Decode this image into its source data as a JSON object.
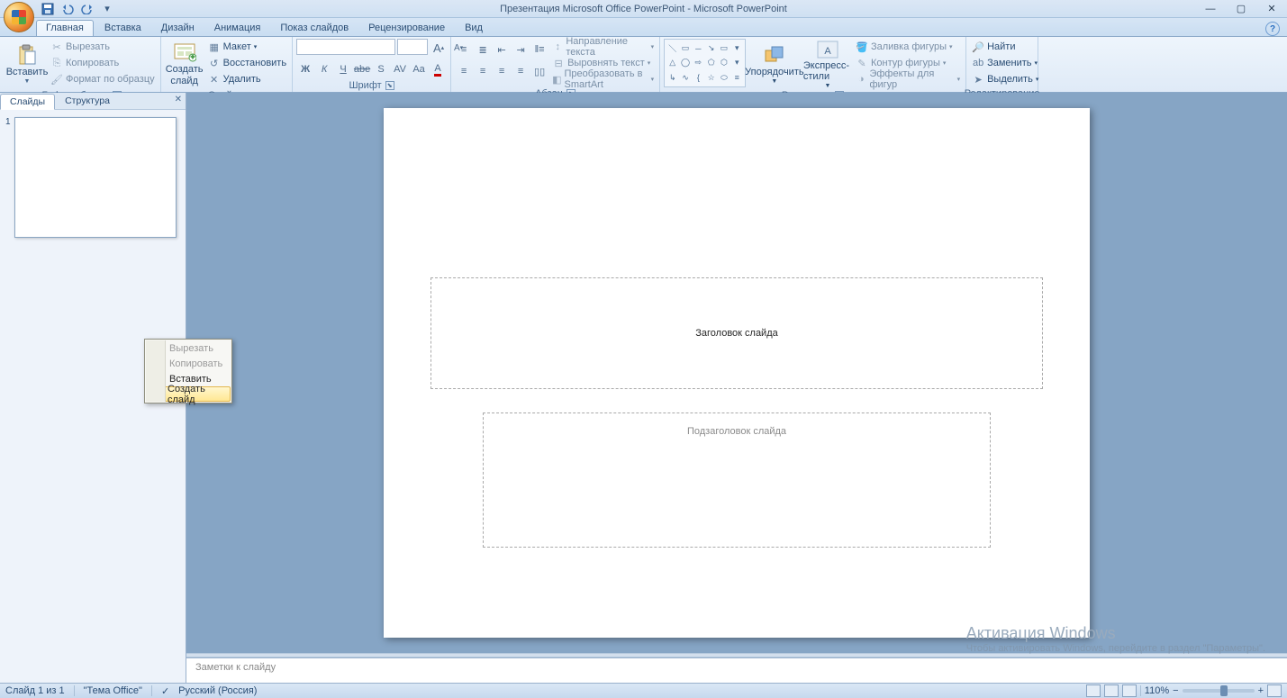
{
  "titlebar": {
    "title": "Презентация Microsoft Office PowerPoint - Microsoft PowerPoint"
  },
  "tabs": [
    "Главная",
    "Вставка",
    "Дизайн",
    "Анимация",
    "Показ слайдов",
    "Рецензирование",
    "Вид"
  ],
  "ribbon": {
    "clipboard": {
      "paste": "Вставить",
      "cut": "Вырезать",
      "copy": "Копировать",
      "format": "Формат по образцу",
      "label": "Буфер обмена"
    },
    "slides": {
      "new": "Создать\nслайд",
      "layout": "Макет",
      "reset": "Восстановить",
      "delete": "Удалить",
      "label": "Слайды"
    },
    "font": {
      "label": "Шрифт"
    },
    "para": {
      "dir": "Направление текста",
      "align": "Выровнять текст",
      "smart": "Преобразовать в SmartArt",
      "label": "Абзац"
    },
    "drawing": {
      "arrange": "Упорядочить",
      "styles": "Экспресс-стили",
      "fill": "Заливка фигуры",
      "outline": "Контур фигуры",
      "effects": "Эффекты для фигур",
      "label": "Рисование"
    },
    "editing": {
      "find": "Найти",
      "replace": "Заменить",
      "select": "Выделить",
      "label": "Редактирование"
    }
  },
  "nav": {
    "tabs": [
      "Слайды",
      "Структура"
    ],
    "slideNum": "1"
  },
  "slide": {
    "title": "Заголовок слайда",
    "subtitle": "Подзаголовок слайда"
  },
  "notes": {
    "placeholder": "Заметки к слайду"
  },
  "context": {
    "cut": "Вырезать",
    "copy": "Копировать",
    "paste": "Вставить",
    "newslide": "Создать слайд"
  },
  "status": {
    "slide": "Слайд 1 из 1",
    "theme": "\"Тема Office\"",
    "lang": "Русский (Россия)",
    "zoom": "110%"
  },
  "watermark": {
    "l1": "Активация Windows",
    "l2": "Чтобы активировать Windows, перейдите в раздел \"Параметры\"."
  }
}
